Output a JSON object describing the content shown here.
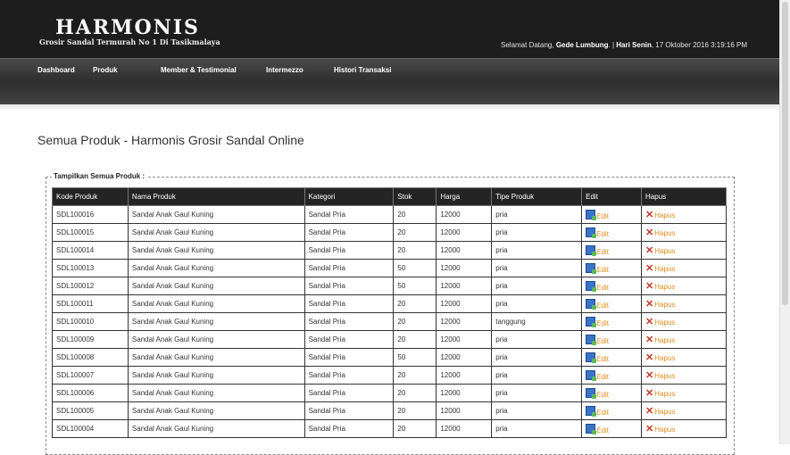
{
  "header": {
    "logo": "HARMONIS",
    "tagline": "Grosir Sandal Termurah No 1 Di Tasikmalaya",
    "welcome_prefix": "Selamat Datang,",
    "user": "Gede Lumbung",
    "separator": ". |",
    "day": "Hari Senin",
    "datetime": ", 17 Oktober 2016 3:19:16 PM"
  },
  "nav": {
    "dashboard": "Dashboard",
    "produk": "Produk",
    "member": "Member & Testimonial",
    "intermezzo": "Intermezzo",
    "histori": "Histori Transaksi"
  },
  "page_title": "Semua Produk - Harmonis Grosir Sandal Online",
  "fieldset_legend": "Tampilkan Semua Produk :",
  "table": {
    "headers": [
      "Kode Produk",
      "Nama Produk",
      "Kategori",
      "Stok",
      "Harga",
      "Tipe Produk",
      "Edit",
      "Hapus"
    ],
    "edit_label": "Edit",
    "hapus_label": "Hapus",
    "rows": [
      [
        "SDL100016",
        "Sandal Anak Gaul Kuning",
        "Sandal Pria",
        "20",
        "12000",
        "pria"
      ],
      [
        "SDL100015",
        "Sandal Anak Gaul Kuning",
        "Sandal Pria",
        "20",
        "12000",
        "pria"
      ],
      [
        "SDL100014",
        "Sandal Anak Gaul Kuning",
        "Sandal Pria",
        "20",
        "12000",
        "pria"
      ],
      [
        "SDL100013",
        "Sandal Anak Gaul Kuning",
        "Sandal Pria",
        "50",
        "12000",
        "pria"
      ],
      [
        "SDL100012",
        "Sandal Anak Gaul Kuning",
        "Sandal Pria",
        "50",
        "12000",
        "pria"
      ],
      [
        "SDL100011",
        "Sandal Anak Gaul Kuning",
        "Sandal Pria",
        "20",
        "12000",
        "pria"
      ],
      [
        "SDL100010",
        "Sandal Anak Gaul Kuning",
        "Sandal Pria",
        "20",
        "12000",
        "tanggung"
      ],
      [
        "SDL100009",
        "Sandal Anak Gaul Kuning",
        "Sandal Pria",
        "20",
        "12000",
        "pria"
      ],
      [
        "SDL100008",
        "Sandal Anak Gaul Kuning",
        "Sandal Pria",
        "50",
        "12000",
        "pria"
      ],
      [
        "SDL100007",
        "Sandal Anak Gaul Kuning",
        "Sandal Pria",
        "20",
        "12000",
        "pria"
      ],
      [
        "SDL100006",
        "Sandal Anak Gaul Kuning",
        "Sandal Pria",
        "20",
        "12000",
        "pria"
      ],
      [
        "SDL100005",
        "Sandal Anak Gaul Kuning",
        "Sandal Pria",
        "20",
        "12000",
        "pria"
      ],
      [
        "SDL100004",
        "Sandal Anak Gaul Kuning",
        "Sandal Pria",
        "20",
        "12000",
        "pria"
      ]
    ]
  },
  "icons": {
    "edit": "edit-icon",
    "hapus": "delete-x-icon"
  },
  "colors": {
    "header_bg": "#1d1d1d",
    "action_text": "#e38c1a",
    "delete_icon": "#c0392b"
  }
}
